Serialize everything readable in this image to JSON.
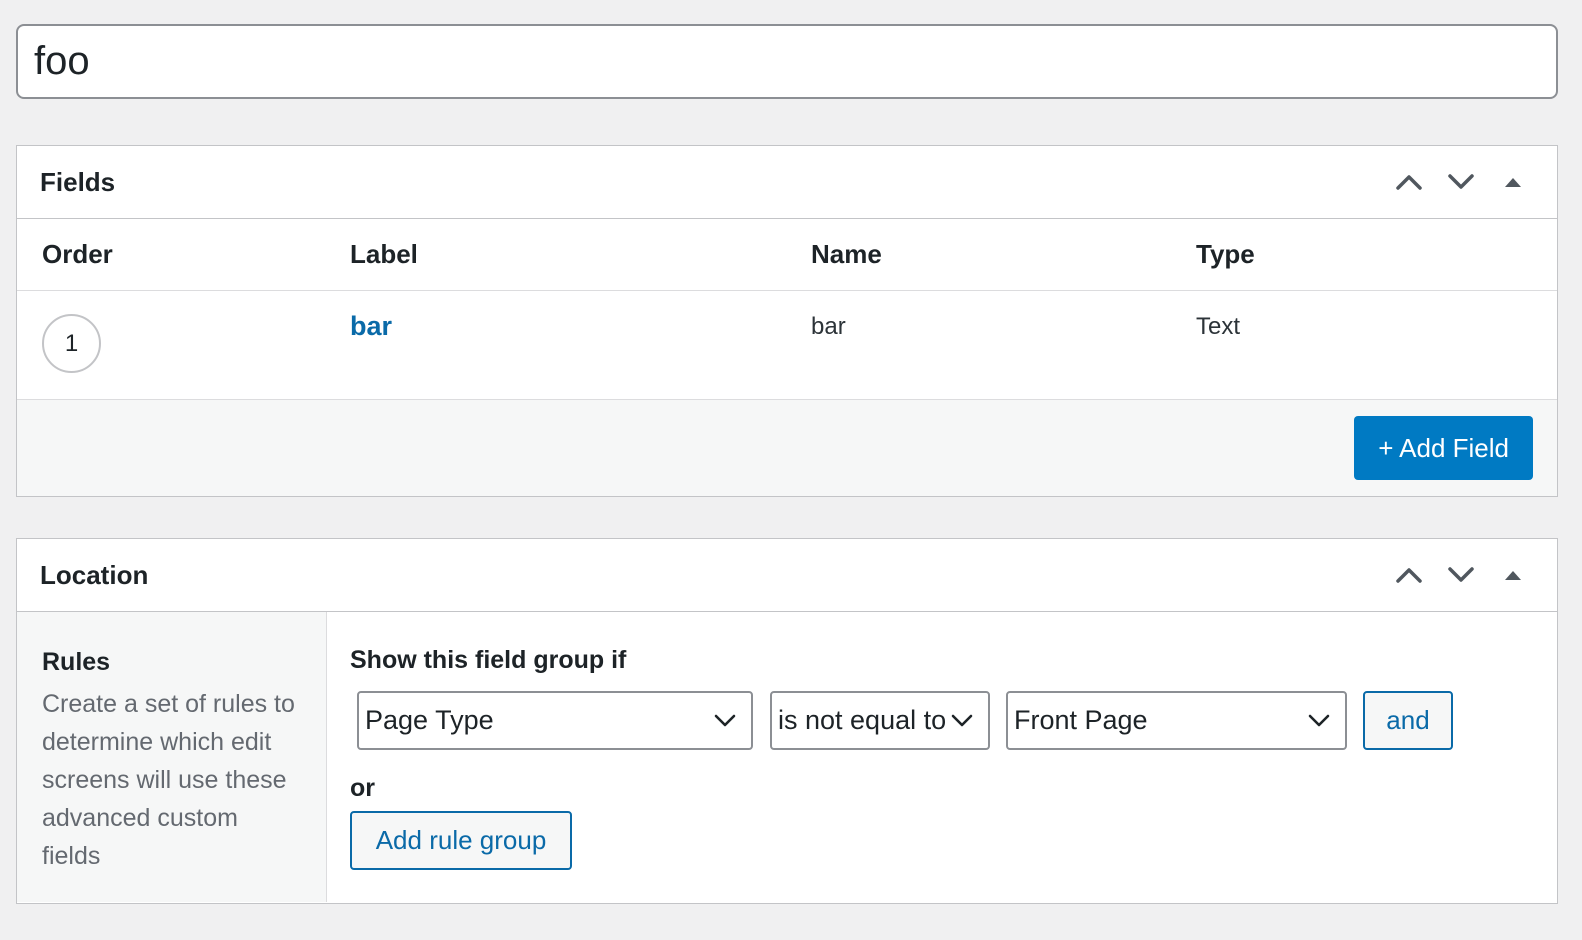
{
  "title_input": {
    "value": "foo"
  },
  "fields_box": {
    "title": "Fields",
    "columns": [
      "Order",
      "Label",
      "Name",
      "Type"
    ],
    "rows": [
      {
        "order": "1",
        "label": "bar",
        "name": "bar",
        "type": "Text"
      }
    ],
    "add_button": "+ Add Field"
  },
  "location_box": {
    "title": "Location",
    "rules_title": "Rules",
    "rules_description": "Create a set of rules to determine which edit screens will use these advanced custom fields",
    "heading": "Show this field group if",
    "rule": {
      "param": "Page Type",
      "operator": "is not equal to",
      "value": "Front Page"
    },
    "and_button": "and",
    "or_label": "or",
    "add_group_button": "Add rule group"
  },
  "icons": {
    "move_up": "chevron-up-icon",
    "move_down": "chevron-down-icon",
    "toggle": "triangle-up-icon",
    "select_arrow": "chevron-down-icon"
  },
  "colors": {
    "accent": "#007ac3",
    "link": "#0a6aa8",
    "background": "#f0f0f1"
  }
}
